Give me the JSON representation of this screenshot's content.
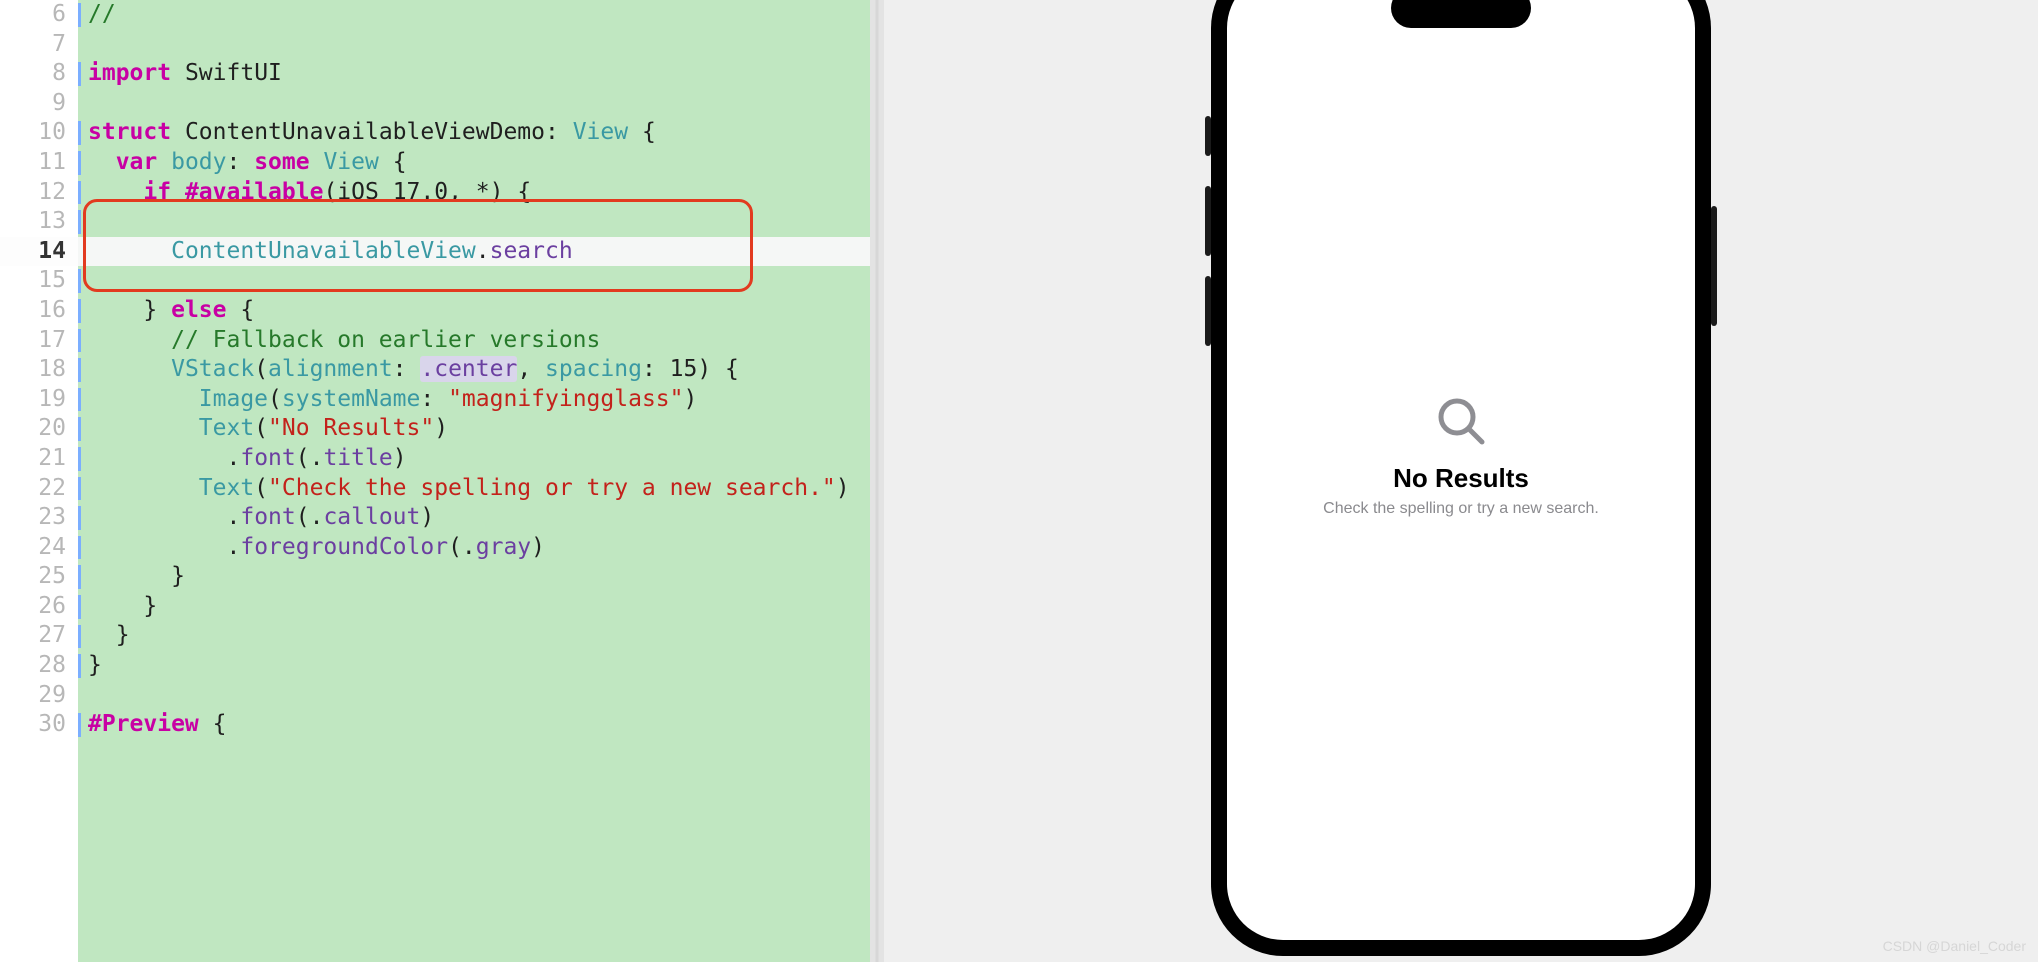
{
  "editor": {
    "first_line_number": 6,
    "current_line_number": 14,
    "highlight_box": {
      "top_line": 13,
      "bottom_line": 15
    },
    "lines": [
      [
        {
          "cls": "tok-cmt",
          "t": "//"
        }
      ],
      [],
      [
        {
          "cls": "tok-kw",
          "t": "import"
        },
        {
          "cls": "",
          "t": " "
        },
        {
          "cls": "tok-id",
          "t": "SwiftUI"
        }
      ],
      [],
      [
        {
          "cls": "tok-kw",
          "t": "struct"
        },
        {
          "cls": "",
          "t": " "
        },
        {
          "cls": "tok-id",
          "t": "ContentUnavailableViewDemo"
        },
        {
          "cls": "tok-op",
          "t": ": "
        },
        {
          "cls": "tok-type",
          "t": "View"
        },
        {
          "cls": "",
          "t": " "
        },
        {
          "cls": "tok-op",
          "t": "{"
        }
      ],
      [
        {
          "cls": "",
          "t": "  "
        },
        {
          "cls": "tok-kw",
          "t": "var"
        },
        {
          "cls": "",
          "t": " "
        },
        {
          "cls": "tok-type",
          "t": "body"
        },
        {
          "cls": "tok-op",
          "t": ": "
        },
        {
          "cls": "tok-kw",
          "t": "some"
        },
        {
          "cls": "",
          "t": " "
        },
        {
          "cls": "tok-type",
          "t": "View"
        },
        {
          "cls": "",
          "t": " "
        },
        {
          "cls": "tok-op",
          "t": "{"
        }
      ],
      [
        {
          "cls": "",
          "t": "    "
        },
        {
          "cls": "tok-kw",
          "t": "if"
        },
        {
          "cls": "",
          "t": " "
        },
        {
          "cls": "tok-kw",
          "t": "#available"
        },
        {
          "cls": "tok-op",
          "t": "("
        },
        {
          "cls": "tok-id",
          "t": "iOS"
        },
        {
          "cls": "",
          "t": " "
        },
        {
          "cls": "tok-num",
          "t": "17.0"
        },
        {
          "cls": "tok-op",
          "t": ", *"
        },
        {
          "cls": "tok-op",
          "t": ") {"
        }
      ],
      [],
      [
        {
          "cls": "",
          "t": "      "
        },
        {
          "cls": "tok-type",
          "t": "ContentUnavailableView"
        },
        {
          "cls": "tok-op",
          "t": "."
        },
        {
          "cls": "tok-attr",
          "t": "search"
        }
      ],
      [],
      [
        {
          "cls": "",
          "t": "    "
        },
        {
          "cls": "tok-op",
          "t": "} "
        },
        {
          "cls": "tok-kw",
          "t": "else"
        },
        {
          "cls": "",
          "t": " "
        },
        {
          "cls": "tok-op",
          "t": "{"
        }
      ],
      [
        {
          "cls": "",
          "t": "      "
        },
        {
          "cls": "tok-cmt",
          "t": "// Fallback on earlier versions"
        }
      ],
      [
        {
          "cls": "",
          "t": "      "
        },
        {
          "cls": "tok-type",
          "t": "VStack"
        },
        {
          "cls": "tok-op",
          "t": "("
        },
        {
          "cls": "tok-type",
          "t": "alignment"
        },
        {
          "cls": "tok-op",
          "t": ": "
        },
        {
          "cls": "tok-hl tok-dot",
          "t": ".center"
        },
        {
          "cls": "tok-op",
          "t": ", "
        },
        {
          "cls": "tok-type",
          "t": "spacing"
        },
        {
          "cls": "tok-op",
          "t": ": "
        },
        {
          "cls": "tok-num",
          "t": "15"
        },
        {
          "cls": "tok-op",
          "t": ") {"
        }
      ],
      [
        {
          "cls": "",
          "t": "        "
        },
        {
          "cls": "tok-type",
          "t": "Image"
        },
        {
          "cls": "tok-op",
          "t": "("
        },
        {
          "cls": "tok-type",
          "t": "systemName"
        },
        {
          "cls": "tok-op",
          "t": ": "
        },
        {
          "cls": "tok-str",
          "t": "\"magnifyingglass\""
        },
        {
          "cls": "tok-op",
          "t": ")"
        }
      ],
      [
        {
          "cls": "",
          "t": "        "
        },
        {
          "cls": "tok-type",
          "t": "Text"
        },
        {
          "cls": "tok-op",
          "t": "("
        },
        {
          "cls": "tok-str",
          "t": "\"No Results\""
        },
        {
          "cls": "tok-op",
          "t": ")"
        }
      ],
      [
        {
          "cls": "",
          "t": "          "
        },
        {
          "cls": "tok-op",
          "t": "."
        },
        {
          "cls": "tok-attr",
          "t": "font"
        },
        {
          "cls": "tok-op",
          "t": "(."
        },
        {
          "cls": "tok-attr",
          "t": "title"
        },
        {
          "cls": "tok-op",
          "t": ")"
        }
      ],
      [
        {
          "cls": "",
          "t": "        "
        },
        {
          "cls": "tok-type",
          "t": "Text"
        },
        {
          "cls": "tok-op",
          "t": "("
        },
        {
          "cls": "tok-str",
          "t": "\"Check the spelling or try a new search.\""
        },
        {
          "cls": "tok-op",
          "t": ")"
        }
      ],
      [
        {
          "cls": "",
          "t": "          "
        },
        {
          "cls": "tok-op",
          "t": "."
        },
        {
          "cls": "tok-attr",
          "t": "font"
        },
        {
          "cls": "tok-op",
          "t": "(."
        },
        {
          "cls": "tok-attr",
          "t": "callout"
        },
        {
          "cls": "tok-op",
          "t": ")"
        }
      ],
      [
        {
          "cls": "",
          "t": "          "
        },
        {
          "cls": "tok-op",
          "t": "."
        },
        {
          "cls": "tok-attr",
          "t": "foregroundColor"
        },
        {
          "cls": "tok-op",
          "t": "(."
        },
        {
          "cls": "tok-attr",
          "t": "gray"
        },
        {
          "cls": "tok-op",
          "t": ")"
        }
      ],
      [
        {
          "cls": "",
          "t": "      "
        },
        {
          "cls": "tok-op",
          "t": "}"
        }
      ],
      [
        {
          "cls": "",
          "t": "    "
        },
        {
          "cls": "tok-op",
          "t": "}"
        }
      ],
      [
        {
          "cls": "",
          "t": "  "
        },
        {
          "cls": "tok-op",
          "t": "}"
        }
      ],
      [
        {
          "cls": "tok-op",
          "t": "}"
        }
      ],
      [],
      [
        {
          "cls": "tok-kw",
          "t": "#Preview"
        },
        {
          "cls": "",
          "t": " "
        },
        {
          "cls": "tok-op",
          "t": "{"
        }
      ]
    ],
    "blue_bars": [
      6,
      8,
      10,
      11,
      12,
      13,
      15,
      16,
      17,
      18,
      19,
      20,
      21,
      22,
      23,
      24,
      25,
      26,
      27,
      28,
      30
    ]
  },
  "simulator": {
    "title": "No Results",
    "subtitle": "Check the spelling or try a new search.",
    "icon": "magnifyingglass-icon"
  },
  "watermark": "CSDN @Daniel_Coder"
}
